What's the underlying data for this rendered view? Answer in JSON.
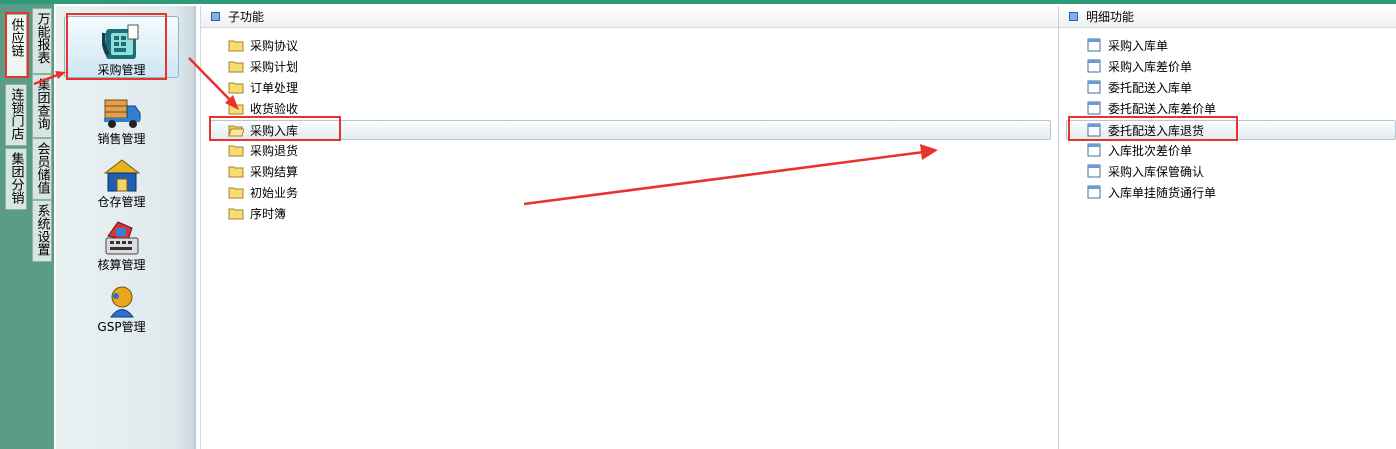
{
  "left_tabs": [
    {
      "label": "供应链",
      "active": true
    },
    {
      "label": "连锁门店",
      "active": false
    },
    {
      "label": "集团分销",
      "active": false
    }
  ],
  "second_tabs": [
    {
      "label": "万能报表"
    },
    {
      "label": "集团查询"
    },
    {
      "label": "会员储值"
    },
    {
      "label": "系统设置"
    }
  ],
  "nav_modules": [
    {
      "label": "采购管理",
      "icon": "purchase-icon",
      "selected": true
    },
    {
      "label": "销售管理",
      "icon": "truck-icon",
      "selected": false
    },
    {
      "label": "仓存管理",
      "icon": "warehouse-icon",
      "selected": false
    },
    {
      "label": "核算管理",
      "icon": "accounting-icon",
      "selected": false
    },
    {
      "label": "GSP管理",
      "icon": "gsp-icon",
      "selected": false
    }
  ],
  "sub_functions": {
    "title": "子功能",
    "items": [
      {
        "label": "采购协议"
      },
      {
        "label": "采购计划"
      },
      {
        "label": "订单处理"
      },
      {
        "label": "收货验收"
      },
      {
        "label": "采购入库",
        "selected": true
      },
      {
        "label": "采购退货"
      },
      {
        "label": "采购结算"
      },
      {
        "label": "初始业务"
      },
      {
        "label": "序时簿"
      }
    ]
  },
  "detail_functions": {
    "title": "明细功能",
    "items": [
      {
        "label": "采购入库单"
      },
      {
        "label": "采购入库差价单"
      },
      {
        "label": "委托配送入库单"
      },
      {
        "label": "委托配送入库差价单"
      },
      {
        "label": "委托配送入库退货",
        "selected": true
      },
      {
        "label": "入库批次差价单"
      },
      {
        "label": "采购入库保管确认"
      },
      {
        "label": "入库单挂随货通行单"
      }
    ]
  },
  "colors": {
    "annotation": "#e8322b",
    "tab_strip": "#5a9c86",
    "top_bar": "#2e9a77"
  }
}
